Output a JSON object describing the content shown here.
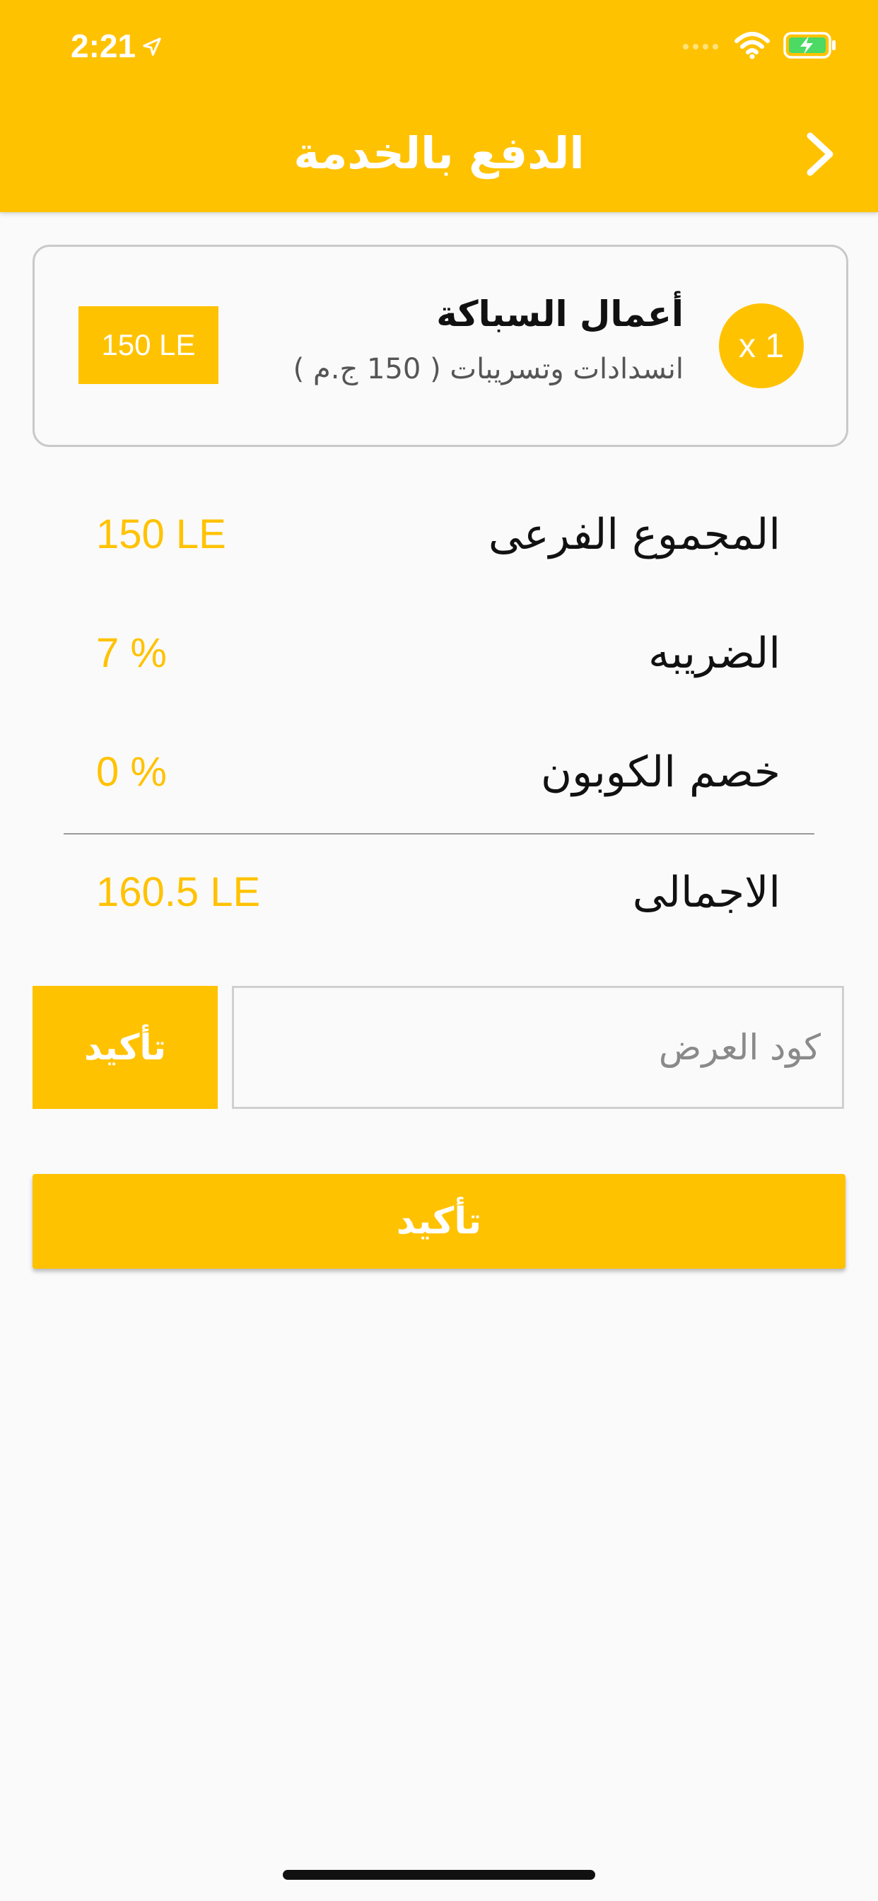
{
  "status_bar": {
    "time": "2:21",
    "icons": [
      "location-arrow-icon",
      "signal-icon",
      "wifi-icon",
      "battery-charging-icon"
    ]
  },
  "header": {
    "title": "الدفع بالخدمة",
    "back_icon": "chevron-right-icon"
  },
  "order_item": {
    "quantity": "x 1",
    "name": "أعمال السباكة",
    "description": "انسدادات وتسريبات ( 150 ج.م )",
    "price": "150 LE"
  },
  "summary": {
    "subtotal_label": "المجموع الفرعى",
    "subtotal_value": "150 LE",
    "tax_label": "الضريبه",
    "tax_value": "7 %",
    "coupon_discount_label": "خصم الكوبون",
    "coupon_discount_value": "0 %",
    "total_label": "الاجمالى",
    "total_value": "160.5 LE"
  },
  "coupon": {
    "placeholder": "كود العرض",
    "value": "",
    "apply_label": "تأكيد"
  },
  "confirm_label": "تأكيد",
  "colors": {
    "accent": "#ffc200",
    "background": "#fafafa",
    "text": "#111111"
  }
}
